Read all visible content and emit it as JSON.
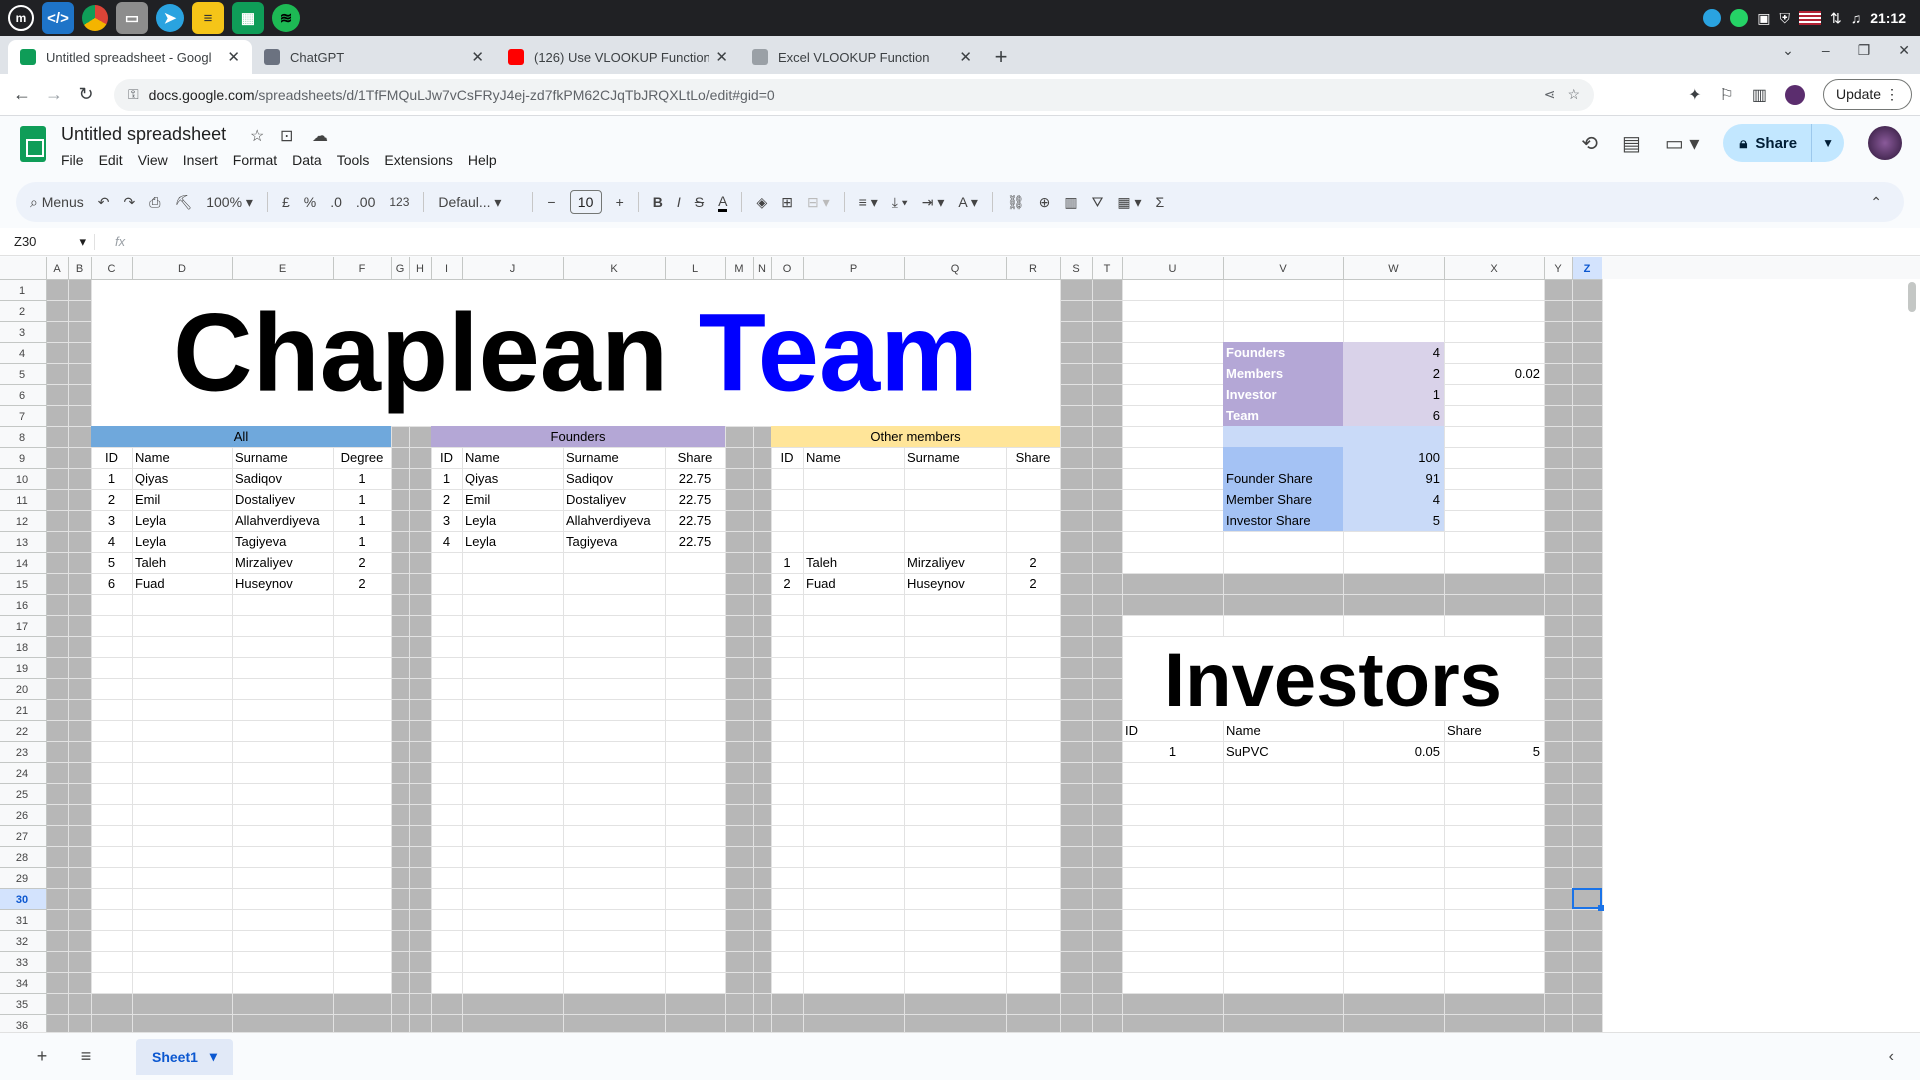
{
  "taskbar": {
    "apps": [
      "lm-menu-icon",
      "vscode-icon",
      "chrome-icon",
      "files-icon",
      "telegram-icon",
      "notes-icon",
      "sheets-icon",
      "spotify-icon"
    ],
    "time": "21:12"
  },
  "browser": {
    "tabs": [
      {
        "title": "Untitled spreadsheet - Googl",
        "icon": "sheets",
        "color": "#0f9d58"
      },
      {
        "title": "ChatGPT",
        "icon": "chatgpt",
        "color": "#6b7280"
      },
      {
        "title": "(126) Use VLOOKUP Function",
        "icon": "youtube",
        "color": "#ff0000"
      },
      {
        "title": "Excel VLOOKUP Function",
        "icon": "globe",
        "color": "#9aa0a6"
      }
    ],
    "url_domain": "docs.google.com",
    "url_path": "/spreadsheets/d/1TfFMQuLJw7vCsFRyJ4ej-zd7fkPM62CJqTbJRQXLtLo/edit#gid=0",
    "update_label": "Update"
  },
  "doc": {
    "title": "Untitled spreadsheet",
    "menus": [
      "File",
      "Edit",
      "View",
      "Insert",
      "Format",
      "Data",
      "Tools",
      "Extensions",
      "Help"
    ],
    "share_label": "Share"
  },
  "toolbar": {
    "menus_label": "Menus",
    "zoom": "100%",
    "currency": "£",
    "percent": "%",
    "dec_dec": ".0",
    "inc_dec": ".00",
    "num_format": "123",
    "font": "Defaul...",
    "font_size": "10"
  },
  "formula": {
    "cell_ref": "Z30",
    "fx": "fx",
    "content": ""
  },
  "sheet": {
    "columns": [
      {
        "l": "A"
      },
      {
        "l": "B"
      },
      {
        "l": "C"
      },
      {
        "l": "D"
      },
      {
        "l": "E"
      },
      {
        "l": "F"
      },
      {
        "l": "G"
      },
      {
        "l": "H"
      },
      {
        "l": "I"
      },
      {
        "l": "J"
      },
      {
        "l": "K"
      },
      {
        "l": "L"
      },
      {
        "l": "M"
      },
      {
        "l": "N"
      },
      {
        "l": "O"
      },
      {
        "l": "P"
      },
      {
        "l": "Q"
      },
      {
        "l": "R"
      },
      {
        "l": "S"
      },
      {
        "l": "T"
      },
      {
        "l": "U"
      },
      {
        "l": "V"
      },
      {
        "l": "W"
      },
      {
        "l": "X"
      },
      {
        "l": "Y"
      },
      {
        "l": "Z"
      }
    ],
    "row_count": 36,
    "selected": "Z30",
    "titles": [
      {
        "parts": [
          {
            "t": "Chaplean ",
            "color": "#000000"
          },
          {
            "t": "Team",
            "color": "#0000ff"
          }
        ],
        "range": "C1:R7"
      },
      {
        "parts": [
          {
            "t": "Investors",
            "color": "#000000"
          }
        ],
        "range": "U18:X21"
      }
    ],
    "header_bars": [
      {
        "text": "All",
        "range": "C8:F8",
        "bg": "#6fa8dc"
      },
      {
        "text": "Founders",
        "range": "I8:L8",
        "bg": "#b4a7d6"
      },
      {
        "text": "Other members",
        "range": "O8:R8",
        "bg": "#ffe599"
      }
    ],
    "cells": [
      {
        "c": "C9",
        "v": "ID",
        "a": "c"
      },
      {
        "c": "D9",
        "v": "Name"
      },
      {
        "c": "E9",
        "v": "Surname"
      },
      {
        "c": "F9",
        "v": "Degree",
        "a": "c"
      },
      {
        "c": "C10",
        "v": "1",
        "a": "c"
      },
      {
        "c": "D10",
        "v": "Qiyas"
      },
      {
        "c": "E10",
        "v": "Sadiqov"
      },
      {
        "c": "F10",
        "v": "1",
        "a": "c"
      },
      {
        "c": "C11",
        "v": "2",
        "a": "c"
      },
      {
        "c": "D11",
        "v": "Emil"
      },
      {
        "c": "E11",
        "v": "Dostaliyev"
      },
      {
        "c": "F11",
        "v": "1",
        "a": "c"
      },
      {
        "c": "C12",
        "v": "3",
        "a": "c"
      },
      {
        "c": "D12",
        "v": "Leyla"
      },
      {
        "c": "E12",
        "v": "Allahverdiyeva"
      },
      {
        "c": "F12",
        "v": "1",
        "a": "c"
      },
      {
        "c": "C13",
        "v": "4",
        "a": "c"
      },
      {
        "c": "D13",
        "v": "Leyla"
      },
      {
        "c": "E13",
        "v": "Tagiyeva"
      },
      {
        "c": "F13",
        "v": "1",
        "a": "c"
      },
      {
        "c": "C14",
        "v": "5",
        "a": "c"
      },
      {
        "c": "D14",
        "v": "Taleh"
      },
      {
        "c": "E14",
        "v": "Mirzaliyev"
      },
      {
        "c": "F14",
        "v": "2",
        "a": "c"
      },
      {
        "c": "C15",
        "v": "6",
        "a": "c"
      },
      {
        "c": "D15",
        "v": "Fuad"
      },
      {
        "c": "E15",
        "v": "Huseynov"
      },
      {
        "c": "F15",
        "v": "2",
        "a": "c"
      },
      {
        "c": "I9",
        "v": "ID",
        "a": "c"
      },
      {
        "c": "J9",
        "v": "Name"
      },
      {
        "c": "K9",
        "v": "Surname"
      },
      {
        "c": "L9",
        "v": "Share",
        "a": "c"
      },
      {
        "c": "I10",
        "v": "1",
        "a": "c"
      },
      {
        "c": "J10",
        "v": "Qiyas"
      },
      {
        "c": "K10",
        "v": "Sadiqov"
      },
      {
        "c": "L10",
        "v": "22.75",
        "a": "c"
      },
      {
        "c": "I11",
        "v": "2",
        "a": "c"
      },
      {
        "c": "J11",
        "v": "Emil"
      },
      {
        "c": "K11",
        "v": "Dostaliyev"
      },
      {
        "c": "L11",
        "v": "22.75",
        "a": "c"
      },
      {
        "c": "I12",
        "v": "3",
        "a": "c"
      },
      {
        "c": "J12",
        "v": "Leyla"
      },
      {
        "c": "K12",
        "v": "Allahverdiyeva"
      },
      {
        "c": "L12",
        "v": "22.75",
        "a": "c"
      },
      {
        "c": "I13",
        "v": "4",
        "a": "c"
      },
      {
        "c": "J13",
        "v": "Leyla"
      },
      {
        "c": "K13",
        "v": "Tagiyeva"
      },
      {
        "c": "L13",
        "v": "22.75",
        "a": "c"
      },
      {
        "c": "O9",
        "v": "ID",
        "a": "c"
      },
      {
        "c": "P9",
        "v": "Name"
      },
      {
        "c": "Q9",
        "v": "Surname"
      },
      {
        "c": "R9",
        "v": "Share",
        "a": "c"
      },
      {
        "c": "O14",
        "v": "1",
        "a": "c"
      },
      {
        "c": "P14",
        "v": "Taleh"
      },
      {
        "c": "Q14",
        "v": "Mirzaliyev"
      },
      {
        "c": "R14",
        "v": "2",
        "a": "c"
      },
      {
        "c": "O15",
        "v": "2",
        "a": "c"
      },
      {
        "c": "P15",
        "v": "Fuad"
      },
      {
        "c": "Q15",
        "v": "Huseynov"
      },
      {
        "c": "R15",
        "v": "2",
        "a": "c"
      },
      {
        "c": "V4",
        "v": "Founders",
        "b": 1,
        "fg": "#ffffff",
        "bg": "#b4a7d6"
      },
      {
        "c": "W4",
        "v": "4",
        "a": "r",
        "bg": "#d9d2e9"
      },
      {
        "c": "V5",
        "v": "Members",
        "b": 1,
        "fg": "#ffffff",
        "bg": "#b4a7d6"
      },
      {
        "c": "W5",
        "v": "2",
        "a": "r",
        "bg": "#d9d2e9"
      },
      {
        "c": "X5",
        "v": "0.02",
        "a": "r"
      },
      {
        "c": "V6",
        "v": "Investor",
        "b": 1,
        "fg": "#ffffff",
        "bg": "#b4a7d6"
      },
      {
        "c": "W6",
        "v": "1",
        "a": "r",
        "bg": "#d9d2e9"
      },
      {
        "c": "V7",
        "v": "Team",
        "b": 1,
        "fg": "#ffffff",
        "bg": "#b4a7d6"
      },
      {
        "c": "W7",
        "v": "6",
        "a": "r",
        "bg": "#d9d2e9"
      },
      {
        "c": "V8",
        "v": "",
        "bg": "#c9daf8"
      },
      {
        "c": "W8",
        "v": "",
        "bg": "#c9daf8"
      },
      {
        "c": "V9",
        "v": "",
        "bg": "#a4c2f4"
      },
      {
        "c": "W9",
        "v": "100",
        "a": "r",
        "bg": "#c9daf8"
      },
      {
        "c": "V10",
        "v": "Founder Share",
        "bg": "#a4c2f4"
      },
      {
        "c": "W10",
        "v": "91",
        "a": "r",
        "bg": "#c9daf8"
      },
      {
        "c": "V11",
        "v": "Member Share",
        "bg": "#a4c2f4"
      },
      {
        "c": "W11",
        "v": "4",
        "a": "r",
        "bg": "#c9daf8"
      },
      {
        "c": "V12",
        "v": "Investor Share",
        "bg": "#a4c2f4"
      },
      {
        "c": "W12",
        "v": "5",
        "a": "r",
        "bg": "#c9daf8"
      },
      {
        "c": "U22",
        "v": "ID"
      },
      {
        "c": "V22",
        "v": "Name"
      },
      {
        "c": "X22",
        "v": "Share"
      },
      {
        "c": "U23",
        "v": "1",
        "a": "c"
      },
      {
        "c": "V23",
        "v": "SuPVC"
      },
      {
        "c": "W23",
        "v": "0.05",
        "a": "r"
      },
      {
        "c": "X23",
        "v": "5",
        "a": "r"
      }
    ]
  },
  "sheet_tabs": [
    "Sheet1"
  ]
}
